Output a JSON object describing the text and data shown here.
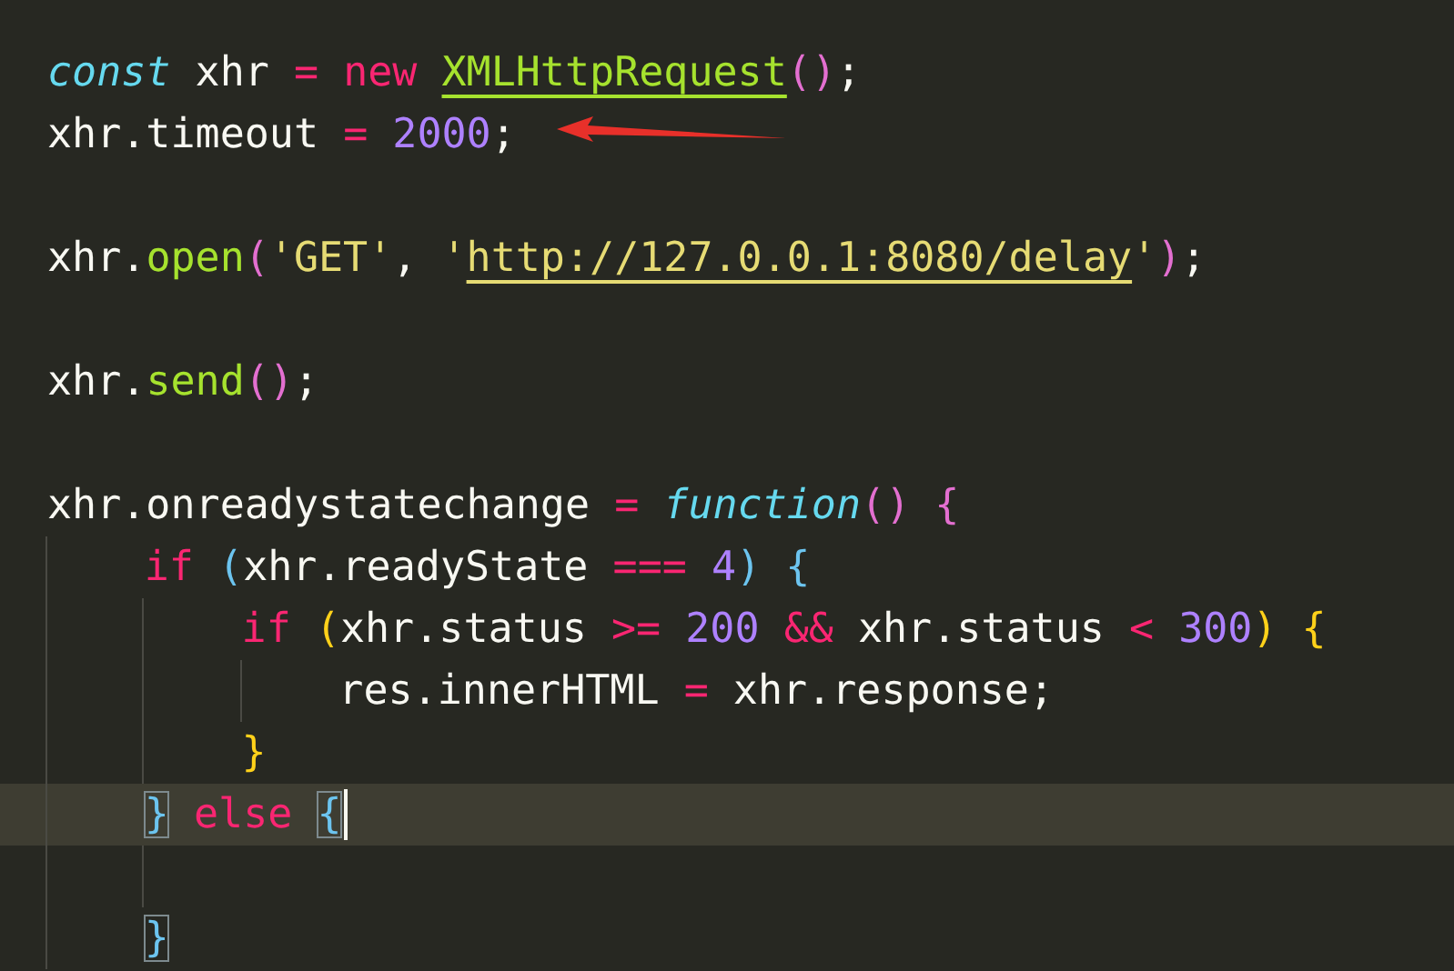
{
  "lines": [
    {
      "kind": "code",
      "current": false,
      "tokens": [
        {
          "kind": "storage",
          "text": "const"
        },
        {
          "kind": "plain",
          "text": " xhr "
        },
        {
          "kind": "op",
          "text": "= "
        },
        {
          "kind": "keyword",
          "text": "new "
        },
        {
          "kind": "class",
          "text": "XMLHttpRequest"
        },
        {
          "kind": "bracket1",
          "text": "()"
        },
        {
          "kind": "plain",
          "text": ";"
        }
      ]
    },
    {
      "kind": "code",
      "current": false,
      "tokens": [
        {
          "kind": "plain",
          "text": "xhr.timeout "
        },
        {
          "kind": "op",
          "text": "= "
        },
        {
          "kind": "number",
          "text": "2000"
        },
        {
          "kind": "plain",
          "text": ";"
        }
      ]
    },
    {
      "kind": "blank"
    },
    {
      "kind": "code",
      "current": false,
      "tokens": [
        {
          "kind": "plain",
          "text": "xhr."
        },
        {
          "kind": "func",
          "text": "open"
        },
        {
          "kind": "bracket1",
          "text": "("
        },
        {
          "kind": "string",
          "text": "'GET'"
        },
        {
          "kind": "plain",
          "text": ", "
        },
        {
          "kind": "string",
          "text": "'"
        },
        {
          "kind": "url",
          "text": "http://127.0.0.1:8080/delay"
        },
        {
          "kind": "string",
          "text": "'"
        },
        {
          "kind": "bracket1",
          "text": ")"
        },
        {
          "kind": "plain",
          "text": ";"
        }
      ]
    },
    {
      "kind": "blank"
    },
    {
      "kind": "code",
      "current": false,
      "tokens": [
        {
          "kind": "plain",
          "text": "xhr."
        },
        {
          "kind": "func",
          "text": "send"
        },
        {
          "kind": "bracket1",
          "text": "()"
        },
        {
          "kind": "plain",
          "text": ";"
        }
      ]
    },
    {
      "kind": "blank"
    },
    {
      "kind": "code",
      "current": false,
      "tokens": [
        {
          "kind": "plain",
          "text": "xhr.onreadystatechange "
        },
        {
          "kind": "op",
          "text": "= "
        },
        {
          "kind": "storage",
          "text": "function"
        },
        {
          "kind": "bracket1",
          "text": "() "
        },
        {
          "kind": "bracket1",
          "text": "{"
        }
      ],
      "children": [
        {
          "kind": "code",
          "current": false,
          "tokens": [
            {
              "kind": "keyword",
              "text": "if "
            },
            {
              "kind": "bracket2",
              "text": "("
            },
            {
              "kind": "plain",
              "text": "xhr.readyState "
            },
            {
              "kind": "op",
              "text": "=== "
            },
            {
              "kind": "number",
              "text": "4"
            },
            {
              "kind": "bracket2",
              "text": ") "
            },
            {
              "kind": "bracket2",
              "text": "{"
            }
          ],
          "children": [
            {
              "kind": "code",
              "current": false,
              "tokens": [
                {
                  "kind": "keyword",
                  "text": "if "
                },
                {
                  "kind": "bracket3",
                  "text": "("
                },
                {
                  "kind": "plain",
                  "text": "xhr.status "
                },
                {
                  "kind": "op",
                  "text": ">= "
                },
                {
                  "kind": "number",
                  "text": "200 "
                },
                {
                  "kind": "op",
                  "text": "&& "
                },
                {
                  "kind": "plain",
                  "text": "xhr.status "
                },
                {
                  "kind": "op",
                  "text": "< "
                },
                {
                  "kind": "number",
                  "text": "300"
                },
                {
                  "kind": "bracket3",
                  "text": ") "
                },
                {
                  "kind": "bracket3",
                  "text": "{"
                }
              ],
              "children": [
                {
                  "kind": "code",
                  "current": false,
                  "tokens": [
                    {
                      "kind": "plain",
                      "text": "res.innerHTML "
                    },
                    {
                      "kind": "op",
                      "text": "= "
                    },
                    {
                      "kind": "plain",
                      "text": "xhr.response;"
                    }
                  ]
                }
              ]
            },
            {
              "kind": "code",
              "current": false,
              "tokens": [
                {
                  "kind": "bracket3",
                  "text": "}"
                }
              ]
            }
          ]
        },
        {
          "kind": "code",
          "current": true,
          "tokens": [
            {
              "kind": "matched",
              "text": "}"
            },
            {
              "kind": "keyword",
              "text": " else "
            },
            {
              "kind": "matched",
              "text": "{"
            }
          ],
          "children": [
            {
              "kind": "blank"
            }
          ]
        },
        {
          "kind": "code",
          "current": false,
          "tokens": [
            {
              "kind": "matched",
              "text": "}"
            }
          ]
        }
      ]
    }
  ]
}
